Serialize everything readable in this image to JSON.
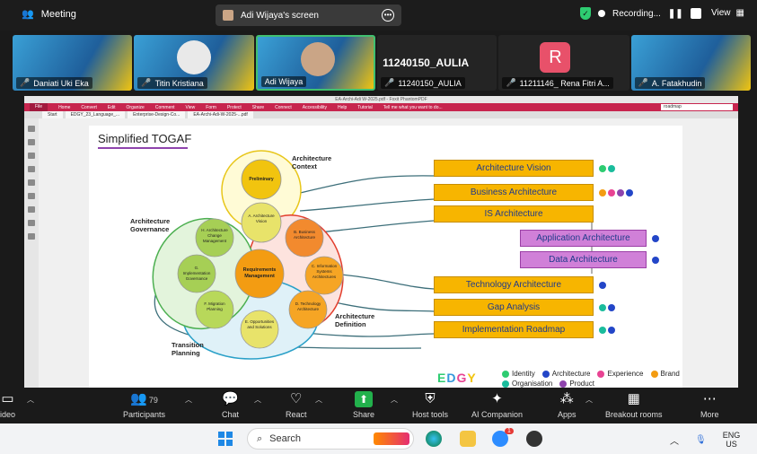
{
  "topbar": {
    "meeting_label": "Meeting",
    "shared_screen_label": "Adi Wijaya's screen",
    "recording_label": "Recording...",
    "view_label": "View"
  },
  "participants": [
    {
      "name": "Daniati Uki Eka",
      "muted": true
    },
    {
      "name": "Titin Kristiana",
      "muted": true
    },
    {
      "name": "Adi Wijaya",
      "muted": false,
      "active": true
    },
    {
      "name": "11240150_AULIA",
      "muted": true,
      "big_label": "11240150_AULIA"
    },
    {
      "name": "11211146_ Rena Fitri A...",
      "muted": true,
      "avatar_letter": "R"
    },
    {
      "name": "A. Fatakhudin",
      "muted": true
    }
  ],
  "pdf": {
    "window_title": "EA-Archi-Adi W-2025.pdf - Foxit PhantomPDF",
    "ribbon_tabs": [
      "File",
      "Home",
      "Convert",
      "Edit",
      "Organize",
      "Comment",
      "View",
      "Form",
      "Protect",
      "Share",
      "Connect",
      "Accessibility",
      "Help",
      "Tutorial"
    ],
    "tell_me": "Tell me what you want to do...",
    "search_value": "roadmap",
    "doc_tabs": [
      "Start",
      "EDGY_23_Language_...",
      "Enterprise-Design-Co...",
      "EA-Archi-Adi-W-2025-...pdf"
    ],
    "slide": {
      "title": "Simplified TOGAF",
      "labels": {
        "context": "Architecture Context",
        "governance": "Architecture Governance",
        "definition": "Architecture Definition",
        "transition": "Transition Planning"
      },
      "circles": {
        "preliminary": "Preliminary",
        "vision": "A. Architecture Vision",
        "business": "B. Business Architecture",
        "info": "C. Information Systems Architectures",
        "tech": "D. Technology Architecture",
        "opps": "E. Opportunities and Solutions",
        "migration": "F. Migration Planning",
        "governance": "G. Implementation Governance",
        "change": "H. Architecture Change Management",
        "requirements": "Requirements Management"
      },
      "boxes": {
        "vision": "Architecture Vision",
        "business": "Business Architecture",
        "is": "IS Architecture",
        "application": "Application Architecture",
        "data": "Data Architecture",
        "technology": "Technology Architecture",
        "gap": "Gap Analysis",
        "roadmap": "Implementation Roadmap"
      },
      "edgy_logo": "EDGY",
      "legend": [
        "Identity",
        "Architecture",
        "Experience",
        "Brand",
        "Organisation",
        "Product"
      ]
    }
  },
  "controls": {
    "video": "ideo",
    "participants": "Participants",
    "participant_count": "79",
    "chat": "Chat",
    "react": "React",
    "share": "Share",
    "host_tools": "Host tools",
    "ai_companion": "AI Companion",
    "apps": "Apps",
    "breakout": "Breakout rooms",
    "more": "More"
  },
  "taskbar": {
    "search_placeholder": "Search",
    "lang_top": "ENG",
    "lang_bottom": "US",
    "zoom_badge": "1"
  },
  "colors": {
    "ribbon": "#c7254e",
    "box_yellow": "#f7b500",
    "box_purple": "#d080d8",
    "active_tile": "#40c070",
    "share_green": "#22b14c"
  }
}
